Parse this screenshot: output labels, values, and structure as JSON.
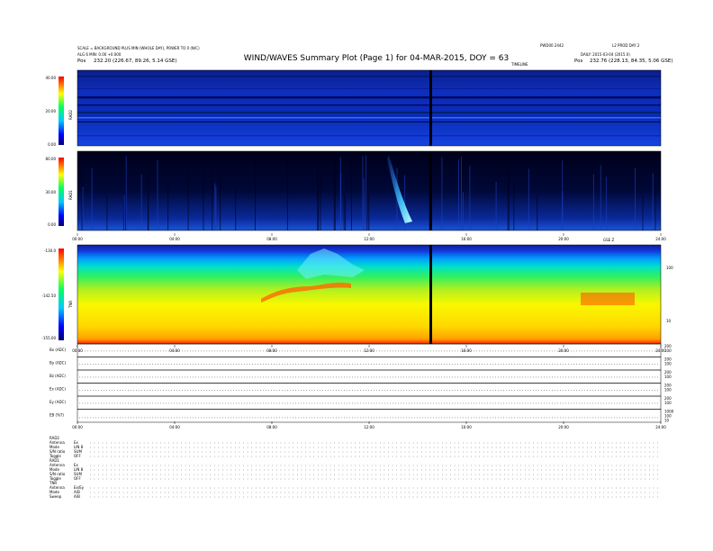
{
  "header": {
    "title": "WIND/WAVES Summary Plot (Page 1) for 04-MAR-2015, DOY = 63",
    "left_line1": "SCALE = BACKGROUND PLUS MIN (WHOLE DAY), POWER TO 0 (N/C)",
    "left_line2": "ALG 6 MIN: 0.00 +0.000",
    "left_line3_label": "Pos",
    "left_line3_value": "232.20 (226.67, 89.26, 5.14 GSE)",
    "right_line1_a": "PWD00 2442",
    "right_line1_b": "L2 PROD DAY 2",
    "right_line2": "DAILY: 2015-03-04 (2015.0)",
    "right_line3_label": "Pos",
    "right_line3_value": "232.76 (228.13, 84.35, 5.06 GSE)",
    "timeline_label": "TIMELINE"
  },
  "panels": {
    "rad2": {
      "label": "RAD2",
      "yticks": [
        "40.00",
        "20.00",
        "0.00"
      ]
    },
    "rad1": {
      "label": "RAD1",
      "yticks": [
        "80.00",
        "30.00",
        "0.00"
      ]
    },
    "tnr": {
      "label": "TNR",
      "yticks": [
        "-130.0",
        "-142.50",
        "-155.00"
      ],
      "right_ticks": [
        "100",
        "10"
      ],
      "right_top": "GSE Z"
    },
    "time_ticks_top": [
      "00:00",
      "04:00",
      "08:00",
      "12:00",
      "16:00",
      "20:00",
      "24:00"
    ],
    "time_ticks_mid": [
      "00:00",
      "04:00",
      "08:00",
      "12:00",
      "16:00",
      "20:00",
      "24:00"
    ],
    "time_ticks_bottom": [
      "00:00",
      "04:00",
      "08:00",
      "12:00",
      "16:00",
      "20:00",
      "24:00"
    ]
  },
  "sub_plots": [
    {
      "label": "Bx (ADC)",
      "right": [
        "200",
        "100"
      ]
    },
    {
      "label": "By (ADC)",
      "right": [
        "200",
        "100"
      ]
    },
    {
      "label": "Bz (ADC)",
      "right": [
        "200",
        "100"
      ]
    },
    {
      "label": "Ex (ADC)",
      "right": [
        "200",
        "100"
      ]
    },
    {
      "label": "Ey (ADC)",
      "right": [
        "200",
        "100"
      ]
    },
    {
      "label": "EB (%T)",
      "right": [
        "1000",
        "100",
        "10"
      ]
    }
  ],
  "status_block": {
    "groups": [
      {
        "name": "RAD2",
        "rows": [
          [
            "Antenna",
            "Ex"
          ],
          [
            "Mode",
            "LIN 8"
          ],
          [
            "S/N ratio",
            "SUM"
          ],
          [
            "Toggle",
            "OFF"
          ]
        ]
      },
      {
        "name": "RAD1",
        "rows": [
          [
            "Antenna",
            "Ex"
          ],
          [
            "Mode",
            "LIN 8"
          ],
          [
            "S/N ratio",
            "SUM"
          ],
          [
            "Toggle",
            "OFF"
          ]
        ]
      },
      {
        "name": "TNR",
        "rows": [
          [
            "Antenna",
            "Ex/Ey"
          ],
          [
            "Mode",
            "A/B"
          ],
          [
            "Sweep",
            "A/B"
          ]
        ]
      }
    ]
  },
  "chart_data": [
    {
      "type": "heatmap",
      "title": "RAD2",
      "xlabel": "",
      "ylabel": "RAD2",
      "xlim": [
        "00:00",
        "24:00"
      ],
      "ylim": [
        0,
        40
      ],
      "colors": [
        "#ff0000",
        "#ffff00",
        "#00ff00",
        "#00c8ff",
        "#0000ff",
        "#000060"
      ],
      "data_gap_time_hours": 14.3
    },
    {
      "type": "heatmap",
      "title": "RAD1",
      "ylabel": "RAD1",
      "xlim": [
        "00:00",
        "24:00"
      ],
      "ylim": [
        0,
        80
      ],
      "type_iii_burst_start_hours": 12.6,
      "data_gap_time_hours": 14.3
    },
    {
      "type": "heatmap",
      "title": "TNR",
      "ylabel": "TNR",
      "xlim": [
        "00:00",
        "24:00"
      ],
      "ylim": [
        -155,
        -130
      ],
      "data_gap_time_hours": 14.3
    }
  ]
}
